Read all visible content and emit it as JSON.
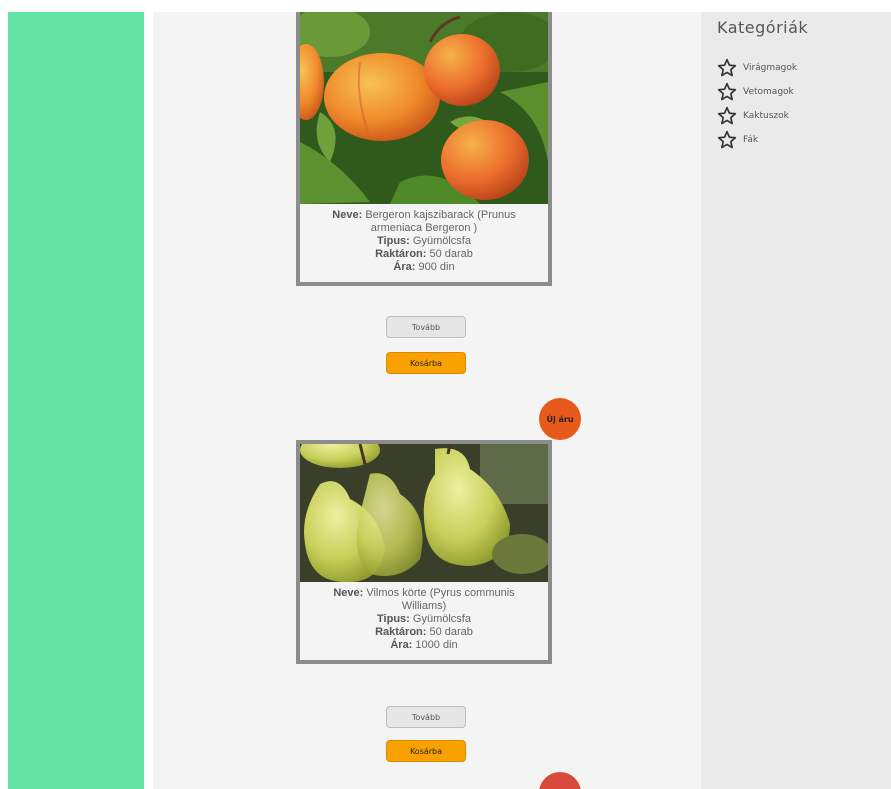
{
  "sidebar": {
    "title": "Kategóriák",
    "items": [
      {
        "label": "Virágmagok",
        "icon": "star-outline-icon"
      },
      {
        "label": "Vetomagok",
        "icon": "star-outline-icon"
      },
      {
        "label": "Kaktuszok",
        "icon": "star-outline-icon"
      },
      {
        "label": "Fák",
        "icon": "star-outline-icon"
      }
    ]
  },
  "products": [
    {
      "name_label": "Neve:",
      "name": "Bergeron kajszibarack (Prunus armeniaca Bergeron )",
      "type_label": "Tipus:",
      "type": "Gyümölcsfa",
      "stock_label": "Raktáron:",
      "stock": "50 darab",
      "price_label": "Ára:",
      "price": "900 din",
      "more_button": "Tovább",
      "cart_button": "Kosárba"
    },
    {
      "name_label": "Neve:",
      "name": "Vilmos körte (Pyrus communis Williams)",
      "type_label": "Tipus:",
      "type": "Gyümölcsfa",
      "stock_label": "Raktáron:",
      "stock": "50 darab",
      "price_label": "Ára:",
      "price": "1000 din",
      "more_button": "Tovább",
      "cart_button": "Kosárba"
    }
  ],
  "new_badge": "Új áru",
  "colors": {
    "left_bar": "#63e3a5",
    "badge": "#e85a1c",
    "cart_button": "#f9a100"
  }
}
